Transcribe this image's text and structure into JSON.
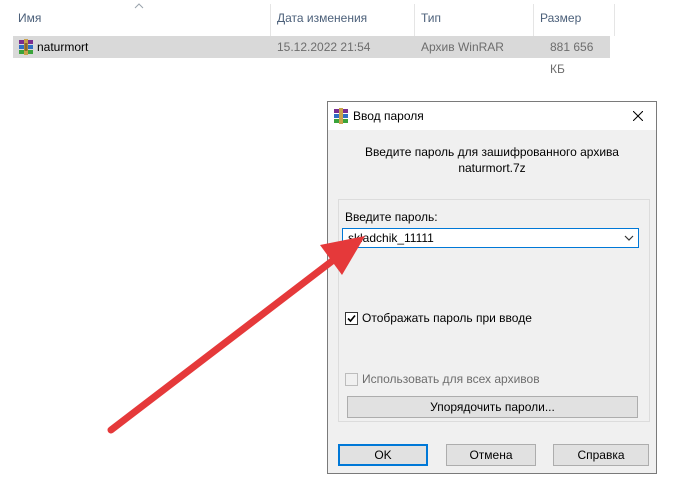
{
  "explorer": {
    "columns": [
      "Имя",
      "Дата изменения",
      "Тип",
      "Размер"
    ],
    "file": {
      "name": "naturmort",
      "date": "15.12.2022 21:54",
      "type": "Архив WinRAR",
      "size": "881 656 КБ",
      "icon": "winrar-archive-icon"
    }
  },
  "dialog": {
    "title": "Ввод пароля",
    "message_line1": "Введите пароль для зашифрованного архива",
    "message_line2": "naturmort.7z",
    "password_label": "Введите пароль:",
    "password_value": "skladchik_11111",
    "show_password_label": "Отображать пароль при вводе",
    "show_password_checked": true,
    "use_for_all_label": "Использовать для всех архивов",
    "use_for_all_checked": false,
    "organize_button": "Упорядочить пароли...",
    "ok_button": "OK",
    "cancel_button": "Отмена",
    "help_button": "Справка"
  },
  "colors": {
    "accent": "#0078d7",
    "arrow": "#e5393a",
    "selected_row": "#d9d9d9"
  }
}
